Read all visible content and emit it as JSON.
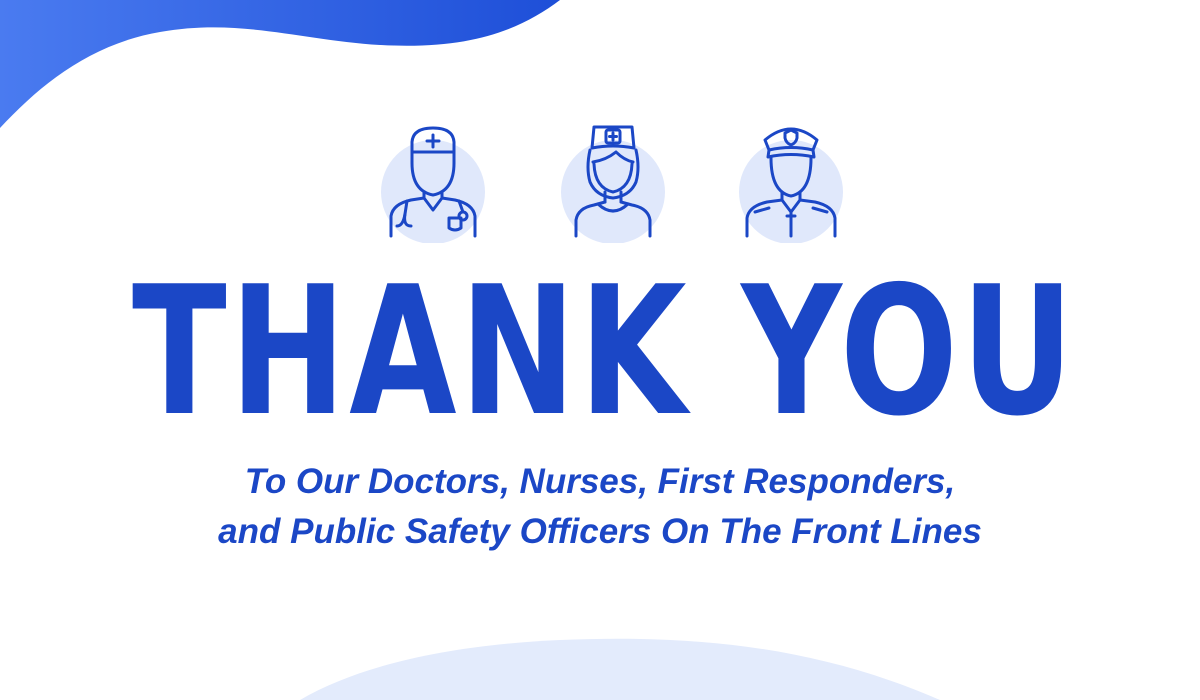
{
  "headline": "THANK YOU",
  "subtitle": {
    "line1": "To Our Doctors, Nurses, First Responders,",
    "line2": "and Public Safety Officers On The Front Lines"
  },
  "icons": [
    "doctor-icon",
    "nurse-icon",
    "police-officer-icon"
  ],
  "colors": {
    "primary": "#1b47c6",
    "icon_stroke": "#1b47c6",
    "icon_circle": "#e0e8fb",
    "blob_top_start": "#4a7bf0",
    "blob_top_end": "#1e4fd8",
    "blob_bottom": "#e3ebfc",
    "background": "#ffffff"
  }
}
